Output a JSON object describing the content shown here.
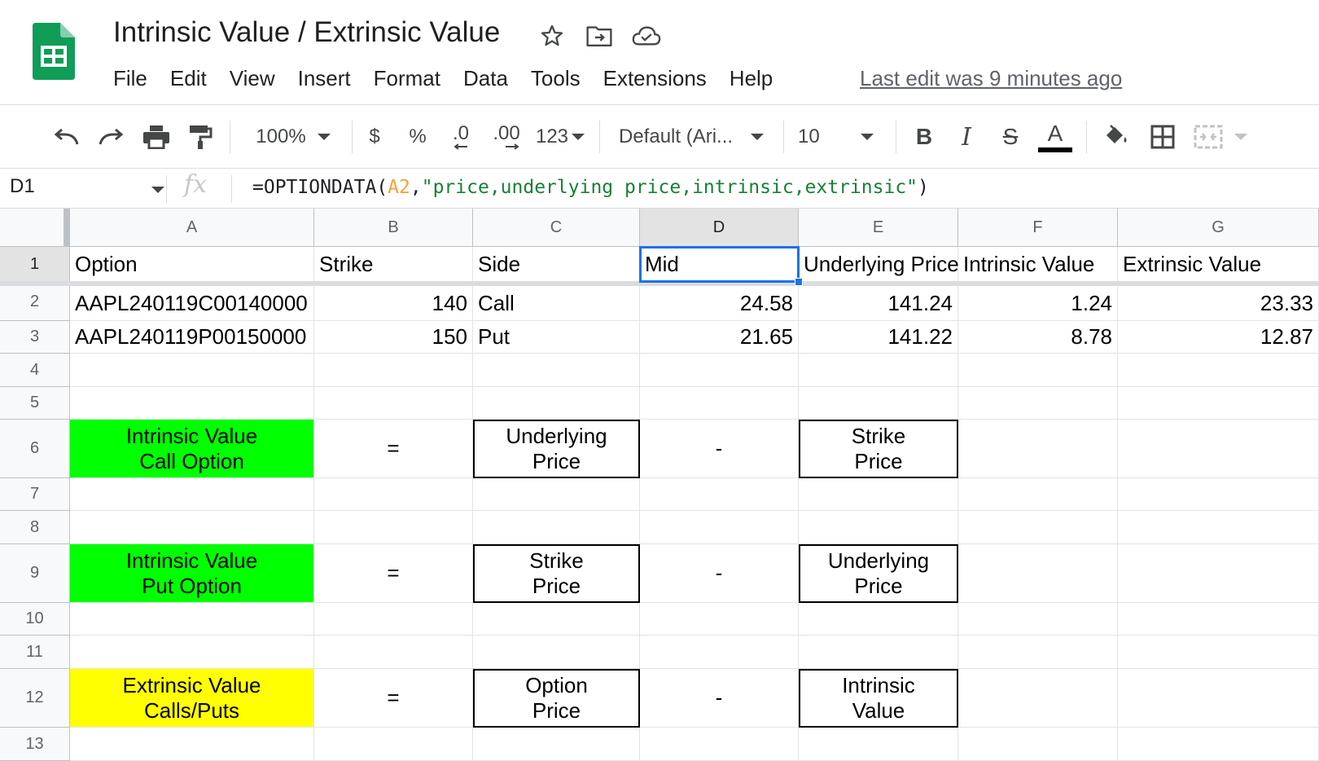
{
  "app": {
    "title": "Intrinsic Value / Extrinsic Value",
    "last_edit": "Last edit was 9 minutes ago",
    "logo_icon": "google-sheets-logo",
    "title_icons": [
      "star-icon",
      "move-to-folder-icon",
      "cloud-saved-icon"
    ]
  },
  "menu": [
    "File",
    "Edit",
    "View",
    "Insert",
    "Format",
    "Data",
    "Tools",
    "Extensions",
    "Help"
  ],
  "toolbar": {
    "zoom": "100%",
    "currency": "$",
    "percent": "%",
    "decrease_decimal": ".0",
    "increase_decimal": ".00",
    "more_formats": "123",
    "font": "Default (Ari...",
    "font_size": "10",
    "bold": "B",
    "italic": "I",
    "strikethrough": "S",
    "text_color": "A",
    "text_color_bar": "#000000",
    "icons": [
      "undo-icon",
      "redo-icon",
      "print-icon",
      "paint-format-icon",
      "fill-color-icon",
      "borders-icon",
      "merge-cells-icon"
    ]
  },
  "formula_bar": {
    "cell_ref": "D1",
    "fx": "fx",
    "formula_prefix": "=OPTIONDATA(",
    "formula_ref": "A2",
    "formula_sep": ",",
    "formula_string": "\"price,underlying price,intrinsic,extrinsic\"",
    "formula_suffix": ")"
  },
  "sheet": {
    "columns": [
      "A",
      "B",
      "C",
      "D",
      "E",
      "F",
      "G"
    ],
    "selected_column": "D",
    "selected_row": "1",
    "rows": [
      "1",
      "2",
      "3",
      "4",
      "5",
      "6",
      "7",
      "8",
      "9",
      "10",
      "11",
      "12",
      "13"
    ],
    "header_row": [
      "Option",
      "Strike",
      "Side",
      "Mid",
      "Underlying Price",
      "Intrinsic Value",
      "Extrinsic Value"
    ],
    "data_rows": [
      [
        "AAPL240119C00140000",
        "140",
        "Call",
        "24.58",
        "141.24",
        "1.24",
        "23.33"
      ],
      [
        "AAPL240119P00150000",
        "150",
        "Put",
        "21.65",
        "141.22",
        "8.78",
        "12.87"
      ]
    ],
    "formulas": [
      {
        "label": "Intrinsic Value\nCall Option",
        "eq": "=",
        "left": "Underlying\nPrice",
        "op": "-",
        "right": "Strike\nPrice",
        "color": "#00ff00"
      },
      {
        "label": "Intrinsic Value\nPut Option",
        "eq": "=",
        "left": "Strike\nPrice",
        "op": "-",
        "right": "Underlying\nPrice",
        "color": "#00ff00"
      },
      {
        "label": "Extrinsic Value\nCalls/Puts",
        "eq": "=",
        "left": "Option\nPrice",
        "op": "-",
        "right": "Intrinsic\nValue",
        "color": "#ffff00"
      }
    ]
  },
  "colors": {
    "selection": "#1a73e8",
    "green_fill": "#00ff00",
    "yellow_fill": "#ffff00",
    "sheets_green": "#0f9d58"
  }
}
